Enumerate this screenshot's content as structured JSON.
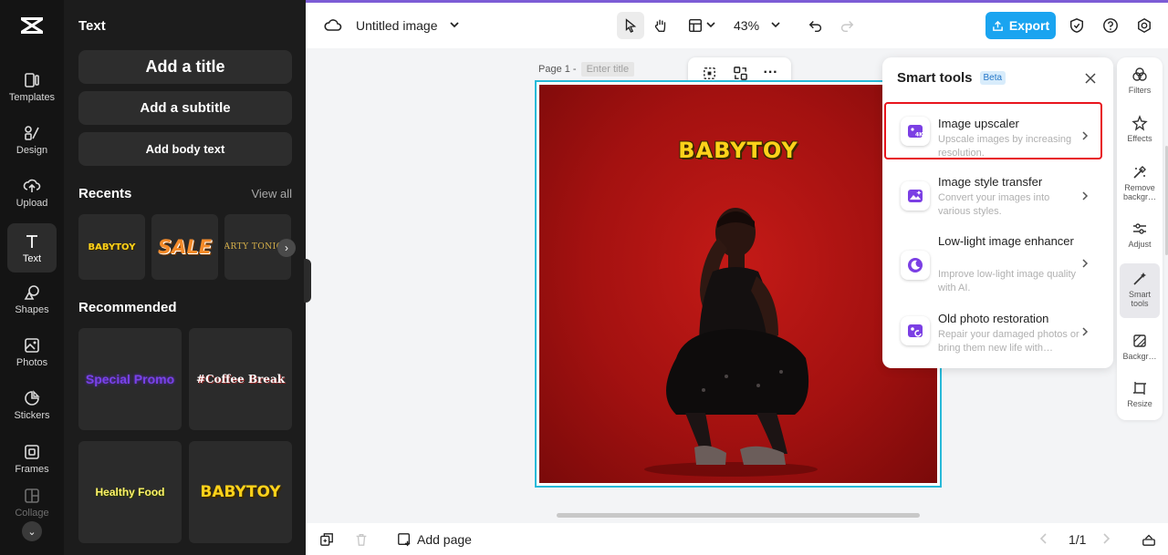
{
  "app": {
    "document_title": "Untitled image",
    "zoom": "43%",
    "export_label": "Export"
  },
  "rail": {
    "items": [
      {
        "label": "Templates",
        "icon": "templates-icon"
      },
      {
        "label": "Design",
        "icon": "design-icon"
      },
      {
        "label": "Upload",
        "icon": "upload-icon"
      },
      {
        "label": "Text",
        "icon": "text-icon",
        "active": true
      },
      {
        "label": "Shapes",
        "icon": "shapes-icon"
      },
      {
        "label": "Photos",
        "icon": "photos-icon"
      },
      {
        "label": "Stickers",
        "icon": "stickers-icon"
      },
      {
        "label": "Frames",
        "icon": "frames-icon"
      },
      {
        "label": "Collage",
        "icon": "collage-icon"
      }
    ]
  },
  "text_panel": {
    "title": "Text",
    "add_title": "Add a title",
    "add_subtitle": "Add a subtitle",
    "add_body": "Add body text",
    "recents_heading": "Recents",
    "view_all": "View all",
    "recents": [
      "BABYTOY",
      "SALE",
      "PARTY TONIGHT"
    ],
    "recommended_heading": "Recommended",
    "recommended": [
      "Special Promo",
      "#Coffee Break",
      "Healthy Food",
      "BABYTOY"
    ]
  },
  "canvas": {
    "page_label": "Page 1 -",
    "page_title_placeholder": "Enter title",
    "headline": "BABYTOY"
  },
  "bottom": {
    "add_page": "Add page",
    "pager": "1/1"
  },
  "smart_tools": {
    "title": "Smart tools",
    "badge": "Beta",
    "tools": [
      {
        "name": "Image upscaler",
        "desc": "Upscale images by increasing resolution.",
        "highlighted": true
      },
      {
        "name": "Image style transfer",
        "desc": "Convert your images into various styles."
      },
      {
        "name": "Low-light image enhancer",
        "desc": "Improve low-light image quality with AI."
      },
      {
        "name": "Old photo restoration",
        "desc": "Repair your damaged photos or bring them new life with…"
      }
    ]
  },
  "right_rail": {
    "items": [
      {
        "label": "Filters",
        "icon": "filters-icon"
      },
      {
        "label": "Effects",
        "icon": "effects-icon"
      },
      {
        "label": "Remove backgr…",
        "icon": "remove-background-icon"
      },
      {
        "label": "Adjust",
        "icon": "adjust-icon"
      },
      {
        "label": "Smart tools",
        "icon": "smart-tools-icon",
        "active": true
      },
      {
        "label": "Backgr…",
        "icon": "background-icon"
      },
      {
        "label": "Resize",
        "icon": "resize-icon"
      }
    ]
  },
  "colors": {
    "accent": "#1aa4f0",
    "highlight": "#e8151d",
    "selection": "#27b9d8",
    "tool_purple": "#7b3fe4"
  }
}
